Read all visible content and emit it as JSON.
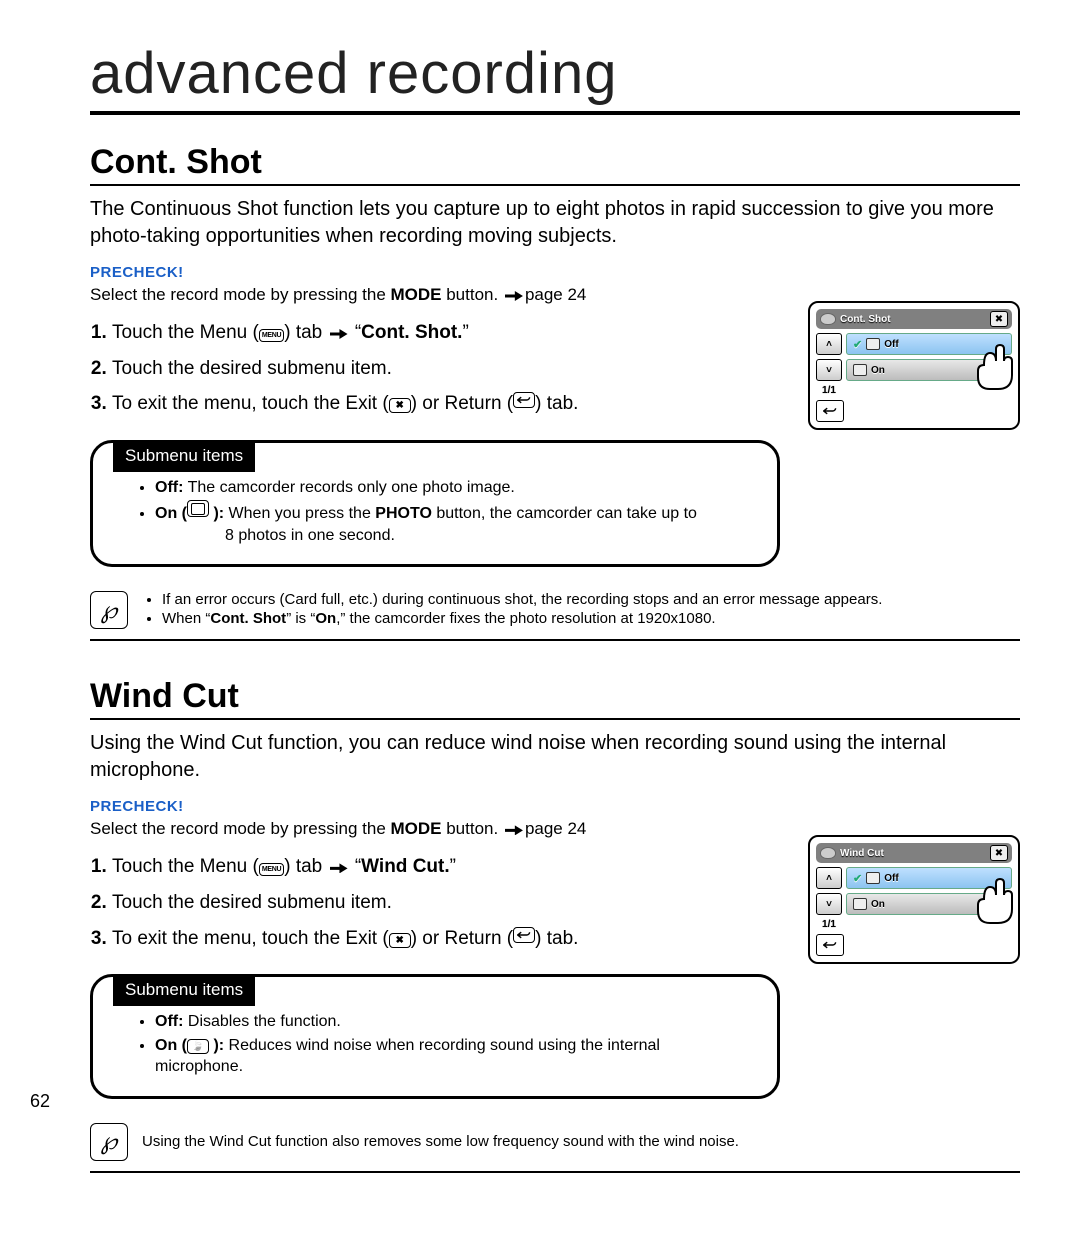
{
  "page_number": "62",
  "chapter_title": "advanced recording",
  "icons": {
    "menu_chip": "MENU",
    "exit_chip": "x",
    "return_chip": "return",
    "note_glyph": "℘"
  },
  "sections": [
    {
      "id": "contshot",
      "title": "Cont. Shot",
      "description": "The Continuous Shot function lets you capture up to eight photos in rapid succession to give you more photo-taking opportunities when recording moving subjects.",
      "precheck_label": "PRECHECK!",
      "precheck_pre": "Select the record mode by pressing the ",
      "precheck_mode": "MODE",
      "precheck_post": " button. ",
      "precheck_page": "page 24",
      "steps": {
        "s1_pre": "Touch the Menu (",
        "s1_mid": ") tab ",
        "s1_arrow": " → “",
        "s1_target": "Cont. Shot.",
        "s1_end": "”",
        "s2": "Touch the desired submenu item.",
        "s3_pre": "To exit the menu, touch the Exit (",
        "s3_mid": ") or Return (",
        "s3_end": ") tab."
      },
      "submenu_label": "Submenu items",
      "submenu": {
        "off_label": "Off:",
        "off_text": " The camcorder records only one photo image.",
        "on_label": "On (",
        "on_post": " ):",
        "on_text_a": " When you press the ",
        "on_photo": "PHOTO",
        "on_text_b": " button, the camcorder can take up to",
        "on_text_c": "8 photos in one second."
      },
      "notes": [
        {
          "text_a": "If an error occurs (Card full, etc.) during continuous shot, the recording stops and an error message appears."
        },
        {
          "text_a": "When “",
          "b1": "Cont. Shot",
          "text_b": "” is “",
          "b2": "On",
          "text_c": ",” the camcorder fixes the photo resolution at 1920x1080."
        }
      ],
      "lcd": {
        "title": "Cont. Shot",
        "page": "1/1",
        "opt_off": "Off",
        "opt_on": "On"
      }
    },
    {
      "id": "windcut",
      "title": "Wind Cut",
      "description": "Using the Wind Cut function, you can reduce wind noise when recording sound using the internal microphone.",
      "precheck_label": "PRECHECK!",
      "precheck_pre": "Select the record mode by pressing the ",
      "precheck_mode": "MODE",
      "precheck_post": " button. ",
      "precheck_page": "page 24",
      "steps": {
        "s1_pre": "Touch the Menu (",
        "s1_mid": ") tab ",
        "s1_arrow": " → “",
        "s1_target": "Wind Cut.",
        "s1_end": "”",
        "s2": "Touch the desired submenu item.",
        "s3_pre": "To exit the menu, touch the Exit (",
        "s3_mid": ") or Return (",
        "s3_end": ") tab."
      },
      "submenu_label": "Submenu items",
      "submenu": {
        "off_label": "Off:",
        "off_text": " Disables the function.",
        "on_label": "On (",
        "on_post": " ):",
        "on_text_a": " Reduces wind noise when recording sound using the internal microphone."
      },
      "notes": [
        {
          "text_a": "Using the Wind Cut function also removes some low frequency sound with the wind noise."
        }
      ],
      "lcd": {
        "title": "Wind Cut",
        "page": "1/1",
        "opt_off": "Off",
        "opt_on": "On"
      }
    }
  ]
}
